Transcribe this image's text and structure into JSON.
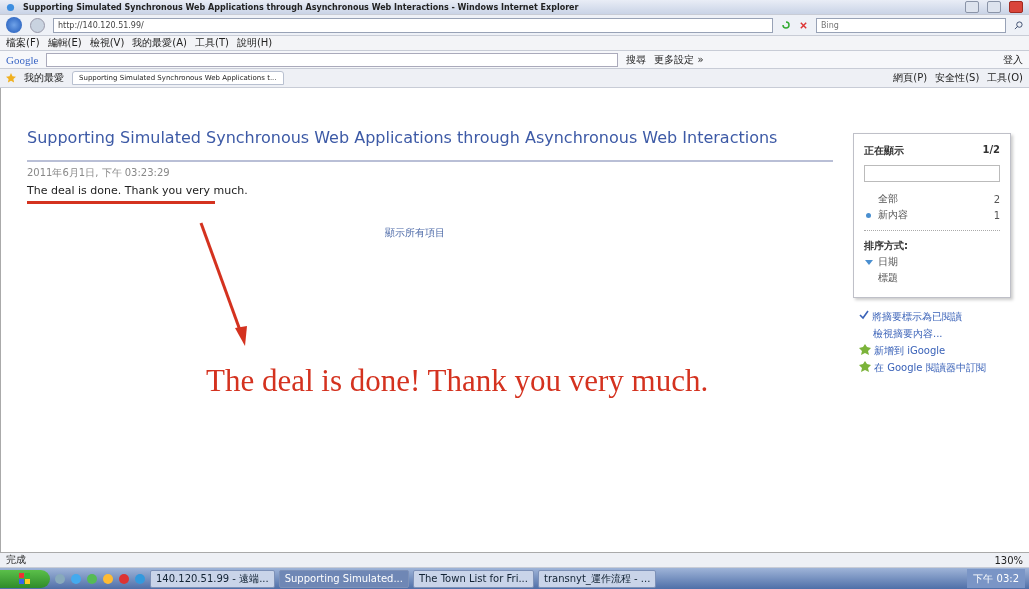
{
  "window": {
    "title": "Supporting Simulated Synchronous Web Applications through Asynchronous Web Interactions - Windows Internet Explorer"
  },
  "address_bar": {
    "url": "http://140.120.51.99/",
    "search_placeholder": "Bing"
  },
  "menu": [
    "檔案(F)",
    "編輯(E)",
    "檢視(V)",
    "我的最愛(A)",
    "工具(T)",
    "說明(H)"
  ],
  "google_toolbar": {
    "logo": "Google",
    "search_button": "搜尋",
    "more": "更多設定 »",
    "sign_in": "登入"
  },
  "favorites_bar": {
    "label": "我的最愛",
    "tabs": [
      {
        "label": "Supporting Simulated Synchronous Web Applications t...",
        "selected": true
      }
    ]
  },
  "command_bar": [
    "網頁(P)",
    "安全性(S)",
    "工具(O)"
  ],
  "page": {
    "title": "Supporting Simulated Synchronous Web Applications through Asynchronous Web Interactions",
    "date": "2011年6月1日, 下午 03:23:29",
    "message": "The deal is done. Thank you very much.",
    "show_all": "顯示所有項目",
    "panel": {
      "heading": "正在顯示",
      "count": "1/2",
      "filters": [
        {
          "label": "全部",
          "count": "2",
          "selected": false
        },
        {
          "label": "新內容",
          "count": "1",
          "selected": true
        }
      ],
      "sort_heading": "排序方式:",
      "sort_options": [
        {
          "label": "日期",
          "selected": true
        },
        {
          "label": "標題",
          "selected": false
        }
      ]
    },
    "links": [
      {
        "kind": "check",
        "label": "將摘要標示為已閱讀"
      },
      {
        "kind": "plain",
        "label": "檢視摘要內容..."
      },
      {
        "kind": "plus",
        "label": "新增到 iGoogle"
      },
      {
        "kind": "plus",
        "label": "在 Google 閱讀器中訂閱"
      }
    ]
  },
  "annotation": {
    "text": "The deal is done! Thank you very much."
  },
  "status_bar": {
    "status": "完成",
    "zoom": "130%"
  },
  "taskbar": {
    "items": [
      {
        "label": "140.120.51.99 - 遠端...",
        "selected": false
      },
      {
        "label": "Supporting Simulated...",
        "selected": true
      },
      {
        "label": "The Town List for Fri...",
        "selected": false
      },
      {
        "label": "transnyt_運作流程 - ...",
        "selected": false
      }
    ],
    "clock": "下午 03:2"
  }
}
